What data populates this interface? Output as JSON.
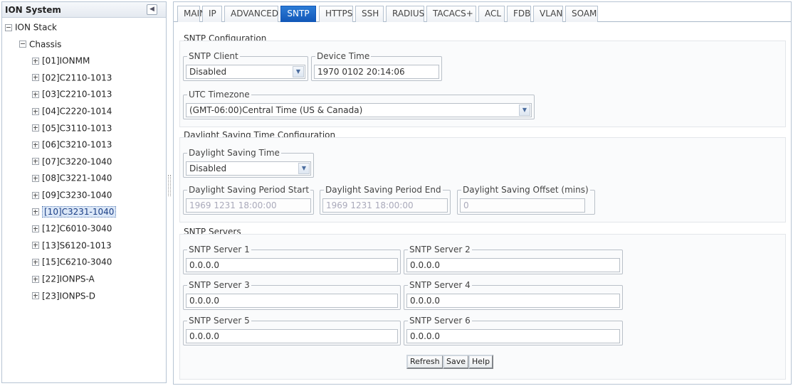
{
  "sidebar": {
    "title": "ION System",
    "collapse_icon": "chevron-left-icon",
    "tree": [
      {
        "label": "ION Stack",
        "toggle": "minus",
        "level": 0
      },
      {
        "label": "Chassis",
        "toggle": "minus",
        "level": 1
      },
      {
        "label": "[01]IONMM",
        "toggle": "plus",
        "level": 2
      },
      {
        "label": "[02]C2110-1013",
        "toggle": "plus",
        "level": 2
      },
      {
        "label": "[03]C2210-1013",
        "toggle": "plus",
        "level": 2
      },
      {
        "label": "[04]C2220-1014",
        "toggle": "plus",
        "level": 2
      },
      {
        "label": "[05]C3110-1013",
        "toggle": "plus",
        "level": 2
      },
      {
        "label": "[06]C3210-1013",
        "toggle": "plus",
        "level": 2
      },
      {
        "label": "[07]C3220-1040",
        "toggle": "plus",
        "level": 2
      },
      {
        "label": "[08]C3221-1040",
        "toggle": "plus",
        "level": 2
      },
      {
        "label": "[09]C3230-1040",
        "toggle": "plus",
        "level": 2
      },
      {
        "label": "[10]C3231-1040",
        "toggle": "plus",
        "level": 2,
        "selected": true
      },
      {
        "label": "[12]C6010-3040",
        "toggle": "plus",
        "level": 2
      },
      {
        "label": "[13]S6120-1013",
        "toggle": "plus",
        "level": 2
      },
      {
        "label": "[15]C6210-3040",
        "toggle": "plus",
        "level": 2
      },
      {
        "label": "[22]IONPS-A",
        "toggle": "plus",
        "level": 2
      },
      {
        "label": "[23]IONPS-D",
        "toggle": "plus",
        "level": 2
      }
    ]
  },
  "tabs": [
    {
      "label": "MAIN"
    },
    {
      "label": "IP"
    },
    {
      "label": "ADVANCED"
    },
    {
      "label": "SNTP",
      "active": true
    },
    {
      "label": "HTTPS"
    },
    {
      "label": "SSH"
    },
    {
      "label": "RADIUS"
    },
    {
      "label": "TACACS+"
    },
    {
      "label": "ACL"
    },
    {
      "label": "FDB"
    },
    {
      "label": "VLAN"
    },
    {
      "label": "SOAM"
    }
  ],
  "sntp_config": {
    "title": "SNTP Configuration",
    "client_label": "SNTP Client",
    "client_value": "Disabled",
    "device_time_label": "Device Time",
    "device_time_value": "1970 0102 20:14:06",
    "timezone_label": "UTC Timezone",
    "timezone_value": "(GMT-06:00)Central Time (US & Canada)"
  },
  "dst_config": {
    "title": "Daylight Saving Time Configuration",
    "dst_label": "Daylight Saving Time",
    "dst_value": "Disabled",
    "start_label": "Daylight Saving Period Start",
    "start_value": "1969 1231 18:00:00",
    "end_label": "Daylight Saving Period End",
    "end_value": "1969 1231 18:00:00",
    "offset_label": "Daylight Saving Offset (mins)",
    "offset_value": "0"
  },
  "servers": {
    "title": "SNTP Servers",
    "items": [
      {
        "label": "SNTP Server 1",
        "value": "0.0.0.0"
      },
      {
        "label": "SNTP Server 2",
        "value": "0.0.0.0"
      },
      {
        "label": "SNTP Server 3",
        "value": "0.0.0.0"
      },
      {
        "label": "SNTP Server 4",
        "value": "0.0.0.0"
      },
      {
        "label": "SNTP Server 5",
        "value": "0.0.0.0"
      },
      {
        "label": "SNTP Server 6",
        "value": "0.0.0.0"
      }
    ]
  },
  "buttons": {
    "refresh": "Refresh",
    "save": "Save",
    "help": "Help"
  },
  "icons": {
    "dropdown": "chevron-down-icon",
    "expand": "plus-icon",
    "collapse": "minus-icon"
  },
  "colors": {
    "active_tab": "#1a63c3",
    "selected_node": "#dbe7f7"
  }
}
